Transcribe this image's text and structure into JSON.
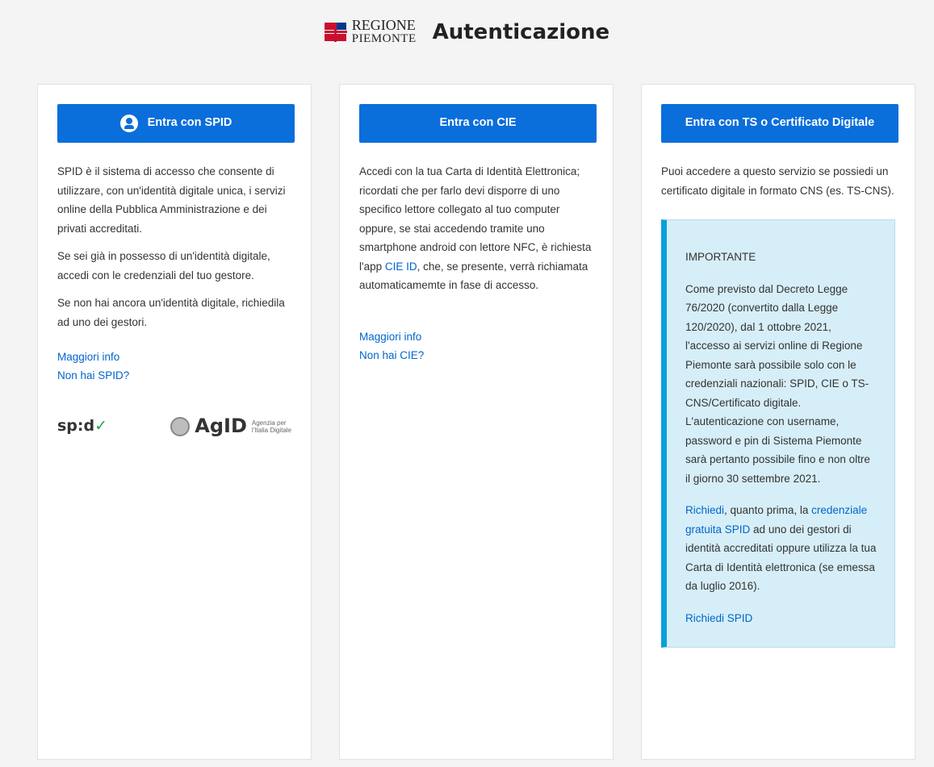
{
  "header": {
    "logo_line1": "REGIONE",
    "logo_line2": "PIEMONTE",
    "title": "Autenticazione"
  },
  "spid": {
    "button_label": "Entra con SPID",
    "p1": "SPID è il sistema di accesso che consente di utilizzare, con un'identità digitale unica, i servizi online della Pubblica Amministrazione e dei privati accreditati.",
    "p2": "Se sei già in possesso di un'identità digitale, accedi con le credenziali del tuo gestore.",
    "p3": "Se non hai ancora un'identità digitale, richiedila ad uno dei gestori.",
    "link_info": "Maggiori info",
    "link_no_spid": "Non hai SPID?",
    "spid_logo_text": "sp:d",
    "spid_logo_tick": "✓",
    "agid_name": "AgID",
    "agid_sub1": "Agenzia per",
    "agid_sub2": "l'Italia Digitale"
  },
  "cie": {
    "button_label": "Entra con CIE",
    "p_before": "Accedi con la tua Carta di Identità Elettronica; ricordati che per farlo devi disporre di uno specifico lettore collegato al tuo computer oppure, se stai accedendo tramite uno smartphone android con lettore NFC, è richiesta l'app ",
    "p_link": "CIE ID",
    "p_after": ", che, se presente, verrà richiamata automaticamemte in fase di accesso.",
    "link_info": "Maggiori info",
    "link_no_cie": "Non hai CIE?"
  },
  "ts": {
    "button_label": "Entra con TS o Certificato Digitale",
    "p1": "Puoi accedere a questo servizio se possiedi un certificato digitale in formato CNS (es. TS-CNS).",
    "important": {
      "title": "IMPORTANTE",
      "p1": "Come previsto dal Decreto Legge 76/2020 (convertito dalla Legge 120/2020), dal 1 ottobre 2021, l'accesso ai servizi online di Regione Piemonte sarà possibile solo con le credenziali nazionali: SPID, CIE o TS-CNS/Certificato digitale. L'autenticazione con username, password e pin di Sistema Piemonte sarà pertanto possibile fino e non oltre il giorno 30 settembre 2021.",
      "p2_link1": "Richiedi",
      "p2_text1": ", quanto prima, la ",
      "p2_link2": "credenziale gratuita SPID",
      "p2_text2": " ad uno dei gestori di identità accreditati oppure utilizza la tua Carta di Identità elettronica (se emessa da luglio 2016).",
      "link_request": "Richiedi SPID"
    }
  },
  "colors": {
    "button_blue": "#0a6edb",
    "info_bg": "#d6eef7",
    "info_border": "#0aa0d8"
  }
}
